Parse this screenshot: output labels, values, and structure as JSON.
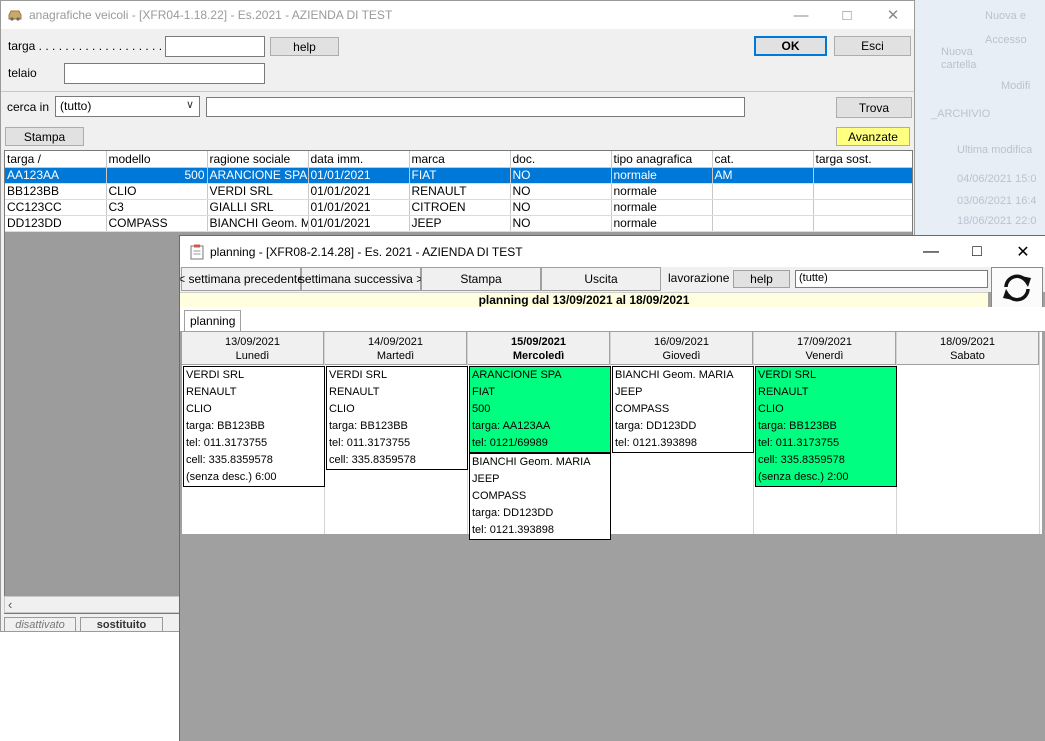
{
  "desktop": {
    "items": [
      "Nuova e",
      "Accesso",
      "Nuova",
      "cartella",
      "Modifi",
      "_ARCHIVIO",
      "Ultima modifica",
      "04/06/2021 15:0",
      "03/06/2021 16:4",
      "18/06/2021 22:0"
    ]
  },
  "win1": {
    "title": "anagrafiche veicoli - [XFR04-1.18.22] - Es.2021 - AZIENDA DI TEST",
    "targa_label": "targa . . . . . . . . . . . . . . . . . . . . .",
    "targa_value": "",
    "telaio_label": "telaio",
    "telaio_value": "",
    "help_label": "help",
    "ok_label": "OK",
    "esci_label": "Esci",
    "cerca_label": "cerca in",
    "cerca_value": "(tutto)",
    "search_value": "",
    "trova_label": "Trova",
    "stampa_label": "Stampa",
    "avanzate_label": "Avanzate",
    "columns": [
      "targa /",
      "modello",
      "ragione sociale",
      "data imm.",
      "marca",
      "doc.",
      "tipo anagrafica",
      "cat.",
      "targa sost."
    ],
    "rows": [
      {
        "targa": "AA123AA",
        "modello": "500",
        "ragione": "ARANCIONE SPA",
        "data": "01/01/2021",
        "marca": "FIAT",
        "doc": "NO",
        "tipo": "normale",
        "cat": "AM",
        "sost": ""
      },
      {
        "targa": "BB123BB",
        "modello": "CLIO",
        "ragione": "VERDI SRL",
        "data": "01/01/2021",
        "marca": "RENAULT",
        "doc": "NO",
        "tipo": "normale",
        "cat": "",
        "sost": ""
      },
      {
        "targa": "CC123CC",
        "modello": "C3",
        "ragione": "GIALLI SRL",
        "data": "01/01/2021",
        "marca": "CITROEN",
        "doc": "NO",
        "tipo": "normale",
        "cat": "",
        "sost": ""
      },
      {
        "targa": "DD123DD",
        "modello": "COMPASS",
        "ragione": "BIANCHI Geom. M",
        "data": "01/01/2021",
        "marca": "JEEP",
        "doc": "NO",
        "tipo": "normale",
        "cat": "",
        "sost": ""
      }
    ],
    "status_disattivato": "disattivato",
    "status_sostituito": "sostituito"
  },
  "win2": {
    "title": "planning - [XFR08-2.14.28] - Es. 2021 - AZIENDA DI TEST",
    "prev_week": "< settimana precedente",
    "next_week": "settimana successiva >",
    "stampa": "Stampa",
    "uscita": "Uscita",
    "lavorazione_label": "lavorazione",
    "help": "help",
    "lavorazione_value": "(tutte)",
    "banner": "planning dal 13/09/2021 al 18/09/2021",
    "tab": "planning",
    "days": [
      {
        "date": "13/09/2021",
        "name": "Lunedì",
        "today": false,
        "cards": [
          {
            "green": false,
            "lines": [
              "VERDI SRL",
              "RENAULT",
              "CLIO",
              "targa: BB123BB",
              "tel: 011.3173755",
              "cell: 335.8359578",
              "(senza desc.) 6:00"
            ]
          }
        ]
      },
      {
        "date": "14/09/2021",
        "name": "Martedì",
        "today": false,
        "cards": [
          {
            "green": false,
            "lines": [
              "VERDI SRL",
              "RENAULT",
              "CLIO",
              "targa: BB123BB",
              "tel: 011.3173755",
              "cell: 335.8359578"
            ]
          }
        ]
      },
      {
        "date": "15/09/2021",
        "name": "Mercoledì",
        "today": true,
        "cards": [
          {
            "green": true,
            "lines": [
              "ARANCIONE SPA",
              "FIAT",
              "500",
              "targa: AA123AA",
              "tel: 0121/69989"
            ]
          },
          {
            "green": false,
            "lines": [
              "BIANCHI Geom. MARIA",
              "JEEP",
              "COMPASS",
              "targa: DD123DD",
              "tel: 0121.393898"
            ]
          }
        ]
      },
      {
        "date": "16/09/2021",
        "name": "Giovedì",
        "today": false,
        "cards": [
          {
            "green": false,
            "lines": [
              "BIANCHI Geom. MARIA",
              "JEEP",
              "COMPASS",
              "targa: DD123DD",
              "tel: 0121.393898"
            ]
          }
        ]
      },
      {
        "date": "17/09/2021",
        "name": "Venerdì",
        "today": false,
        "cards": [
          {
            "green": true,
            "lines": [
              "VERDI SRL",
              "RENAULT",
              "CLIO",
              "targa: BB123BB",
              "tel: 011.3173755",
              "cell: 335.8359578",
              "(senza desc.) 2:00"
            ]
          }
        ]
      },
      {
        "date": "18/09/2021",
        "name": "Sabato",
        "today": false,
        "cards": []
      }
    ]
  },
  "colors": {
    "selection": "#0078d7",
    "green_card": "#00ff80",
    "banner": "#ffffe0",
    "avanzate": "#ffff80"
  }
}
